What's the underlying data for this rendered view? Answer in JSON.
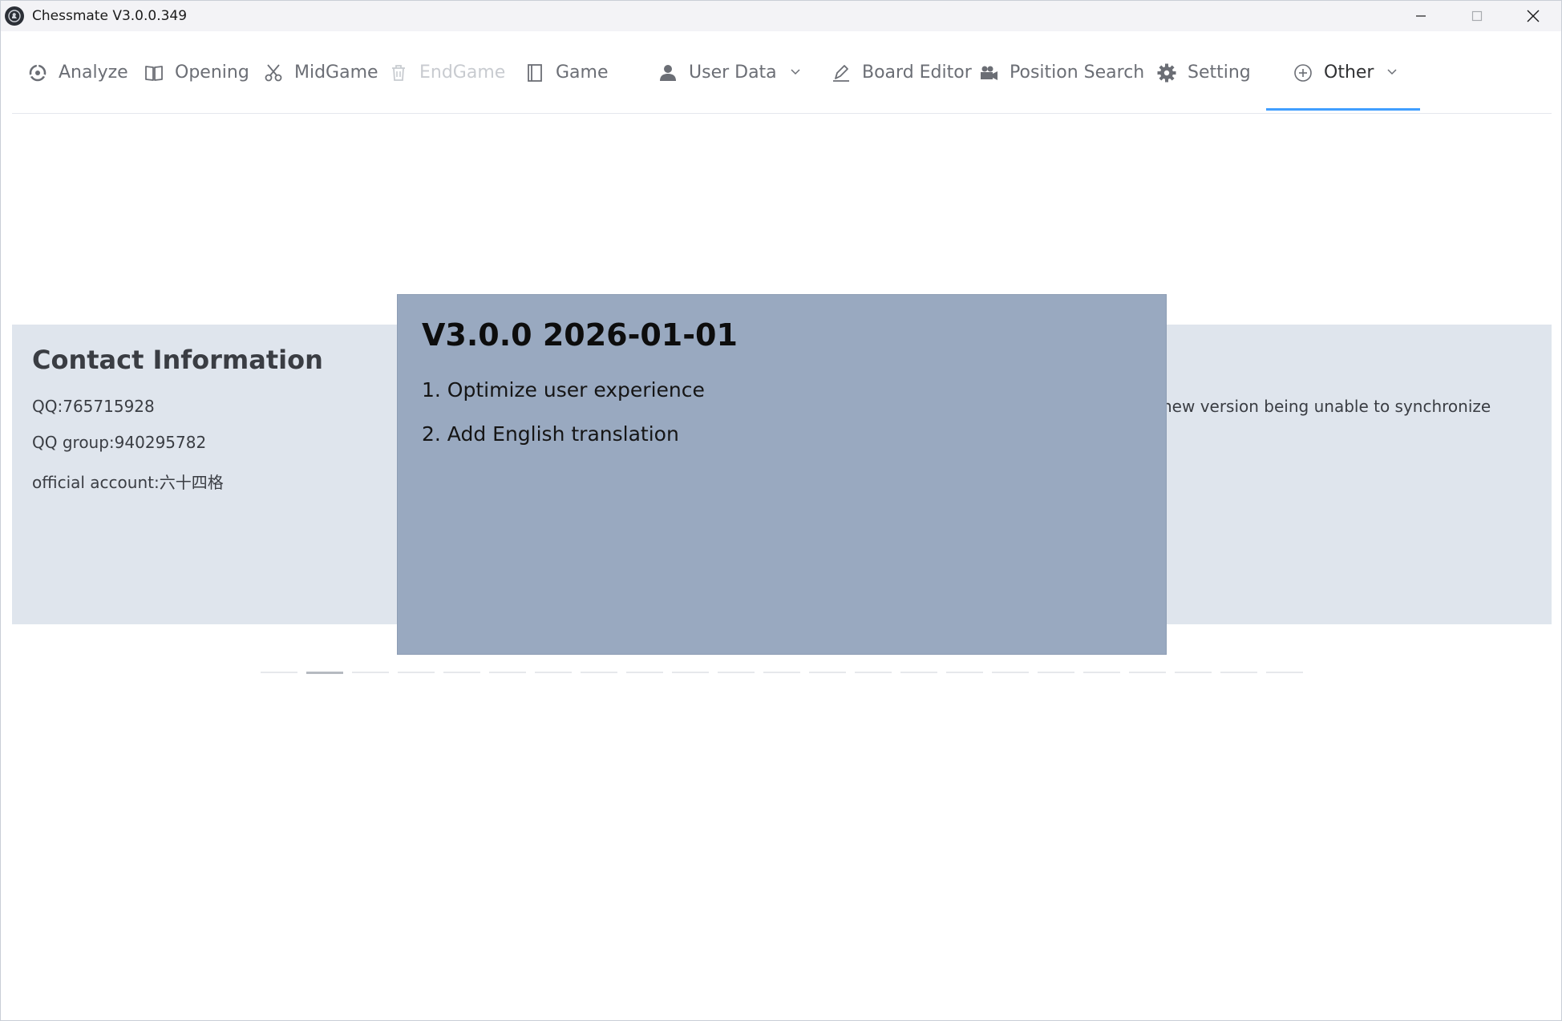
{
  "window": {
    "title": "Chessmate V3.0.0.349"
  },
  "colors": {
    "accent": "#409eff",
    "panel_bg": "#dfe5ed",
    "popup_bg": "#99a9c0"
  },
  "menu": {
    "items": [
      {
        "label": "Analyze",
        "icon": "analyze-icon"
      },
      {
        "label": "Opening",
        "icon": "book-icon"
      },
      {
        "label": "MidGame",
        "icon": "scissors-icon"
      },
      {
        "label": "EndGame",
        "icon": "trash-icon",
        "disabled": true
      },
      {
        "label": "Game",
        "icon": "notebook-icon"
      },
      {
        "label": "User Data",
        "icon": "user-icon",
        "dropdown": true
      },
      {
        "label": "Board Editor",
        "icon": "pencil-icon"
      },
      {
        "label": "Position Search",
        "icon": "camera-icon"
      },
      {
        "label": "Setting",
        "icon": "gear-icon"
      },
      {
        "label": "Other",
        "icon": "plus-circle-icon",
        "dropdown": true,
        "active": true
      }
    ]
  },
  "contact": {
    "title": "Contact Information",
    "qq": "QQ:765715928",
    "qq_group": "QQ group:940295782",
    "official_account": "official account:六十四格"
  },
  "right_panel": {
    "text": "new version being unable to synchronize"
  },
  "popup": {
    "title": "V3.0.0 2026-01-01",
    "lines": [
      "1. Optimize user experience",
      "2. Add English translation"
    ]
  },
  "carousel": {
    "count": 23,
    "active_index": 1
  }
}
